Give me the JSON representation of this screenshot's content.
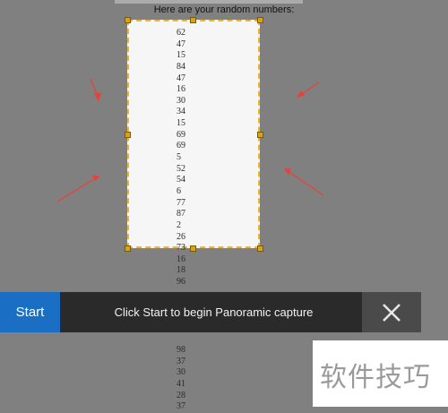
{
  "page": {
    "title": "Here are your random numbers:"
  },
  "numbers": [
    "62",
    "47",
    "15",
    "84",
    "47",
    "16",
    "30",
    "34",
    "15",
    "69",
    "69",
    "5",
    "52",
    "54",
    "6",
    "77",
    "87",
    "2",
    "26",
    "73",
    "16",
    "18",
    "96",
    "",
    "",
    "",
    "",
    "",
    "98",
    "37",
    "30",
    "41",
    "28",
    "37"
  ],
  "capture_bar": {
    "start_label": "Start",
    "hint": "Click Start to begin Panoramic capture",
    "close_icon": "close-x-icon"
  },
  "watermark": {
    "text": "软件技巧"
  },
  "colors": {
    "accent": "#1a6fc4",
    "frame_border": "#f0b429",
    "arrow": "#e8413a",
    "bar_background": "#2a2a2a"
  }
}
